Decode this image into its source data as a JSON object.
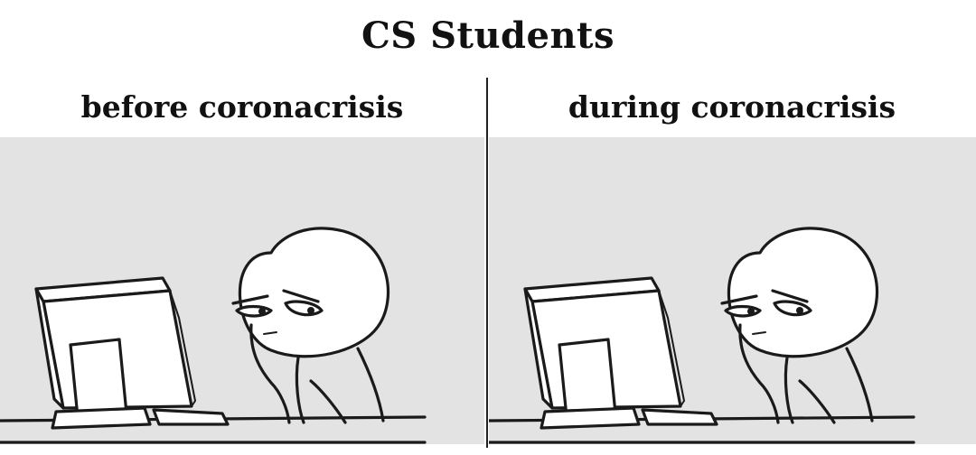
{
  "title": "CS Students",
  "panels": [
    {
      "caption": "before coronacrisis"
    },
    {
      "caption": "during coronacrisis"
    }
  ],
  "colors": {
    "panel_background": "#e3e3e3",
    "ink": "#1a1a1a"
  },
  "icons": [
    "computer-guy-rage-face"
  ]
}
